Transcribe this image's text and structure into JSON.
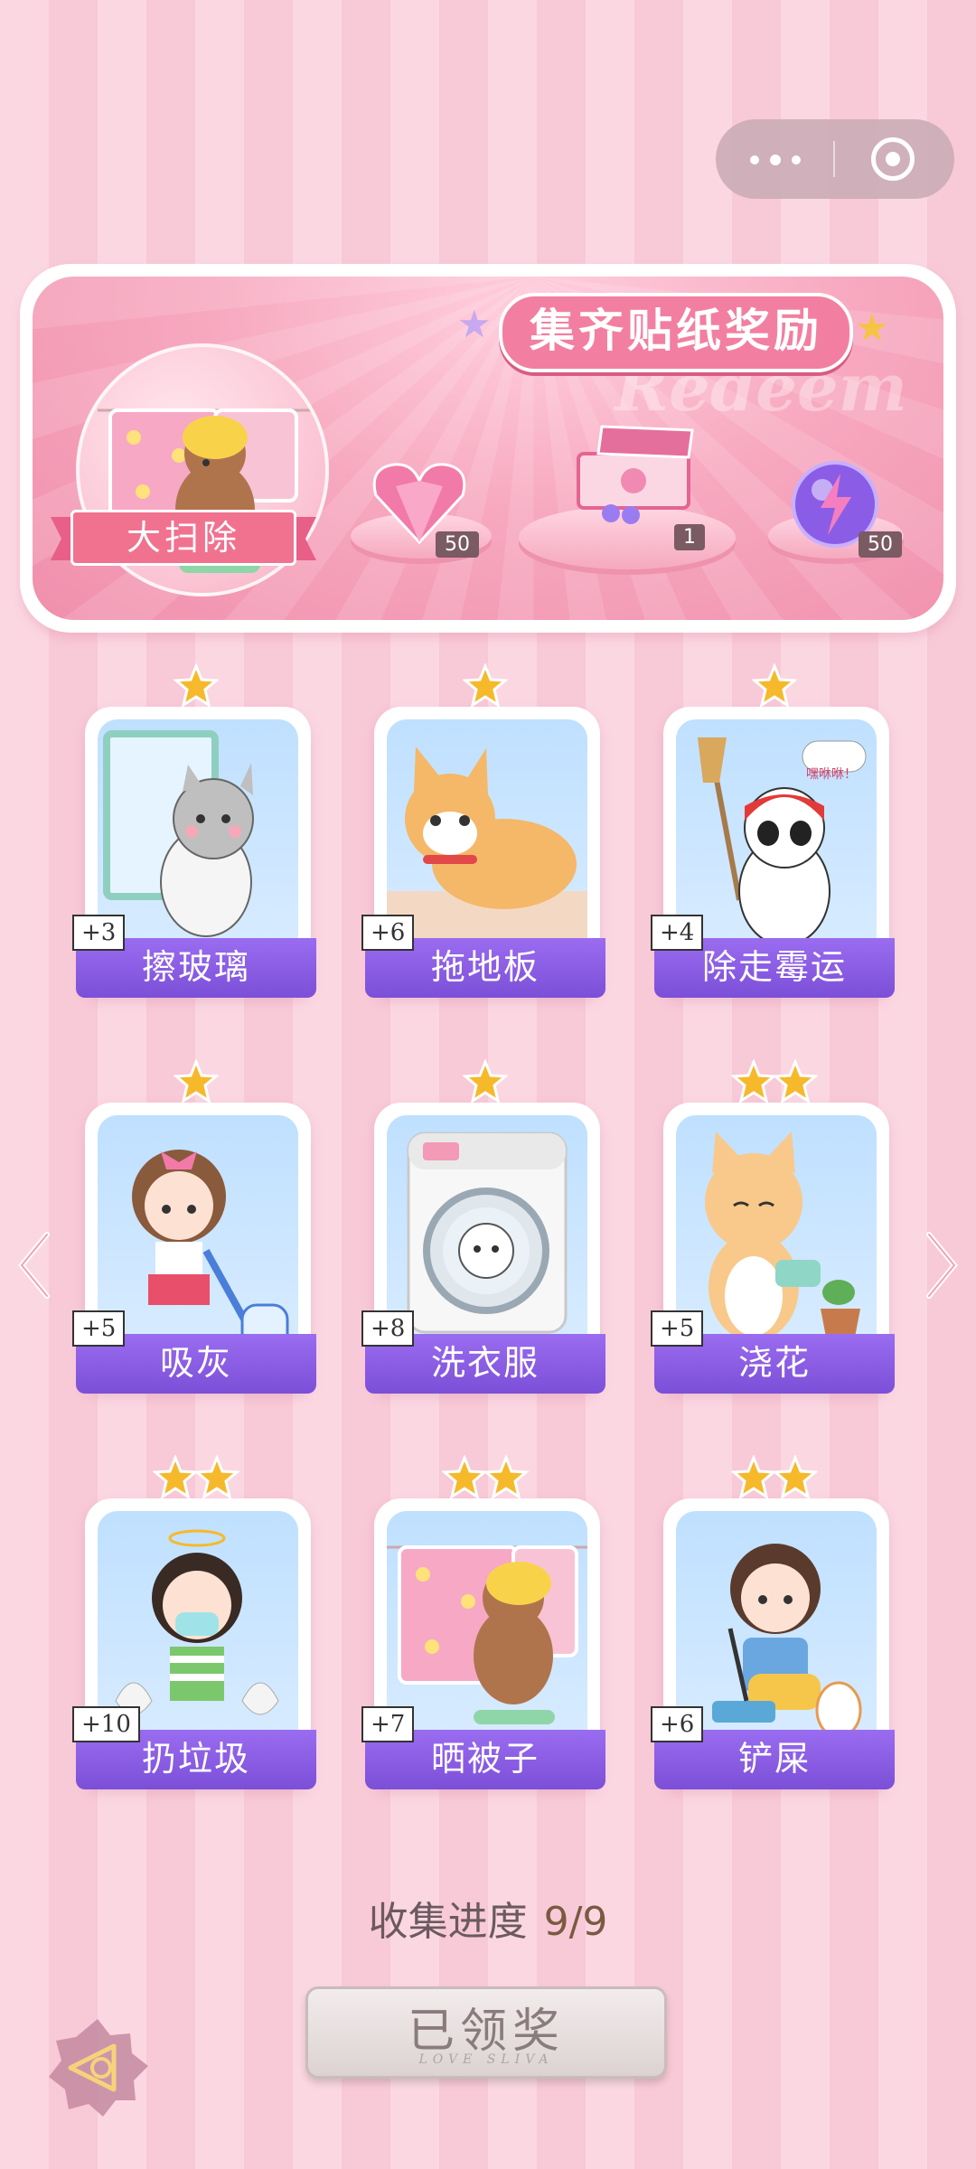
{
  "capsule": {
    "menu_icon": "more-dots-icon",
    "close_icon": "target-circle-icon"
  },
  "banner": {
    "title": "集齐贴纸奖励",
    "watermark": "Redeem",
    "collection_name": "大扫除",
    "rewards": [
      {
        "icon": "pink-heart-gem-icon",
        "count": "50"
      },
      {
        "icon": "gift-box-icon",
        "count": "1"
      },
      {
        "icon": "purple-energy-orb-icon",
        "count": "50"
      }
    ]
  },
  "stickers": [
    {
      "label": "擦玻璃",
      "points": "+3",
      "stars": 1,
      "art": "cat-cleaning-window"
    },
    {
      "label": "拖地板",
      "points": "+6",
      "stars": 1,
      "art": "corgi-mopping-floor"
    },
    {
      "label": "除走霉运",
      "points": "+4",
      "stars": 1,
      "art": "panda-with-broom",
      "speech": "嘿咻咻！"
    },
    {
      "label": "吸灰",
      "points": "+5",
      "stars": 1,
      "art": "girl-vacuuming"
    },
    {
      "label": "洗衣服",
      "points": "+8",
      "stars": 1,
      "art": "cat-in-washing-machine"
    },
    {
      "label": "浇花",
      "points": "+5",
      "stars": 2,
      "art": "cat-watering-plant"
    },
    {
      "label": "扔垃圾",
      "points": "+10",
      "stars": 2,
      "art": "girl-taking-out-trash"
    },
    {
      "label": "晒被子",
      "points": "+7",
      "stars": 2,
      "art": "bear-drying-quilt"
    },
    {
      "label": "铲屎",
      "points": "+6",
      "stars": 2,
      "art": "girl-cleaning-litter"
    }
  ],
  "progress": {
    "label": "收集进度",
    "value": "9/9"
  },
  "claim_button": {
    "label": "已领奖",
    "sub": "LOVE SLIVA"
  },
  "nav": {
    "left_icon": "chevron-left-icon",
    "right_icon": "chevron-right-icon",
    "back_icon": "back-arrow-icon"
  },
  "colors": {
    "label_purple": "#8b5de6",
    "banner_pink": "#f27fa1",
    "star_gold": "#f6b92b"
  }
}
